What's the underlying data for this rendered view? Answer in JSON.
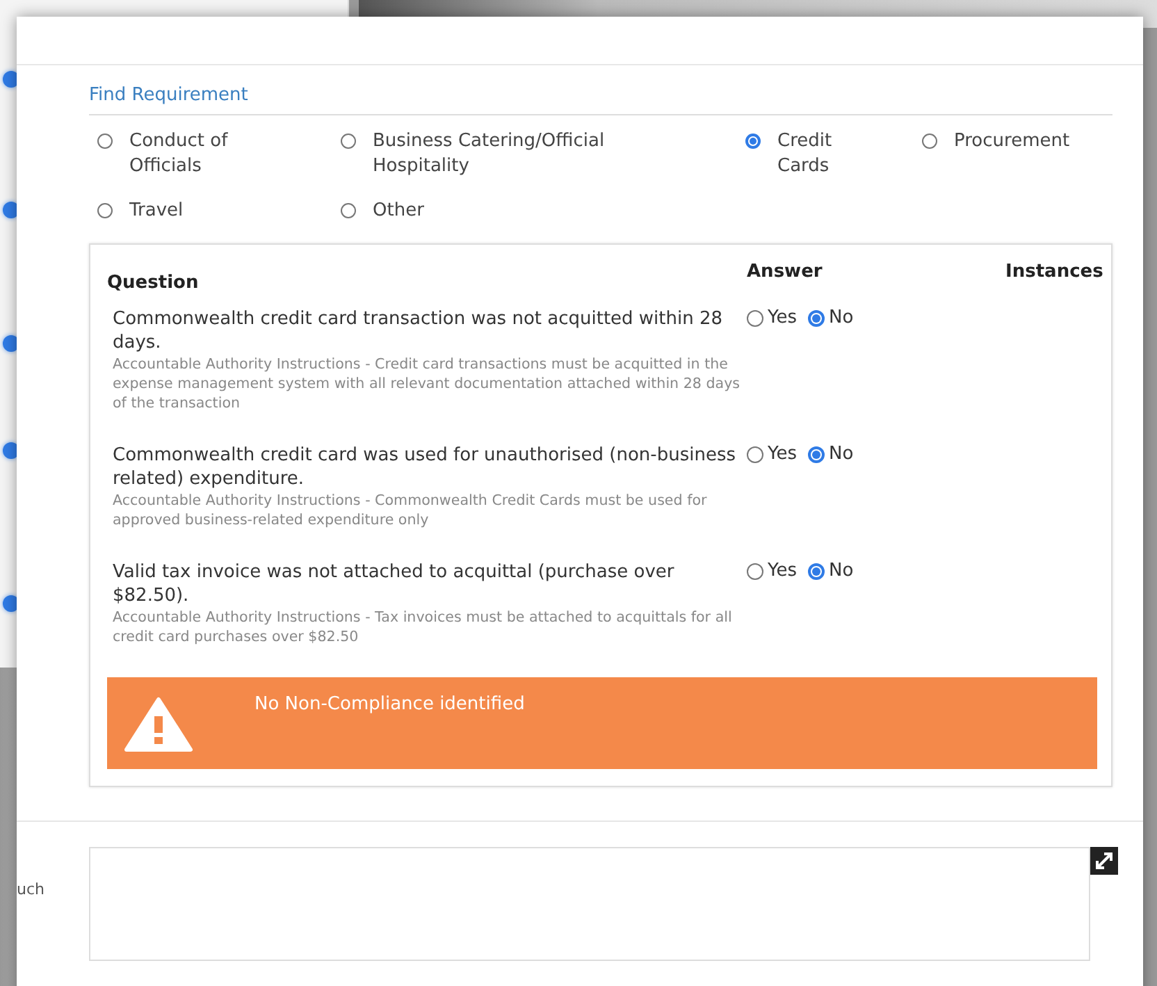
{
  "background": {
    "label_fragment": "uch"
  },
  "section_title": "Find Requirement",
  "categories": [
    {
      "label": "Conduct of Officials",
      "selected": false
    },
    {
      "label": "Business Catering/Official Hospitality",
      "selected": false
    },
    {
      "label": "Credit Cards",
      "selected": true
    },
    {
      "label": "Procurement",
      "selected": false
    },
    {
      "label": "Travel",
      "selected": false
    },
    {
      "label": "Other",
      "selected": false
    }
  ],
  "table": {
    "columns": [
      "Question",
      "Answer",
      "Instances"
    ],
    "rows": [
      {
        "question": "Commonwealth credit card transaction was not acquitted within 28 days.",
        "guidance": "Accountable Authority Instructions - Credit card transactions must be acquitted in the expense management system with all relevant documentation attached within 28 days of the transaction",
        "answers": [
          {
            "label": "Yes",
            "selected": false
          },
          {
            "label": "No",
            "selected": true
          }
        ]
      },
      {
        "question": "Commonwealth credit card was used for unauthorised (non-business related) expenditure.",
        "guidance": "Accountable Authority Instructions - Commonwealth Credit Cards must be used for approved business-related expenditure only",
        "answers": [
          {
            "label": "Yes",
            "selected": false
          },
          {
            "label": "No",
            "selected": true
          }
        ]
      },
      {
        "question": "Valid tax invoice was not attached to acquittal (purchase over $82.50).",
        "guidance": "Accountable Authority Instructions - Tax invoices must be attached to acquittals for all credit card purchases over $82.50",
        "answers": [
          {
            "label": "Yes",
            "selected": false
          },
          {
            "label": "No",
            "selected": true
          }
        ]
      }
    ]
  },
  "alert": {
    "text": "No Non-Compliance identified"
  }
}
